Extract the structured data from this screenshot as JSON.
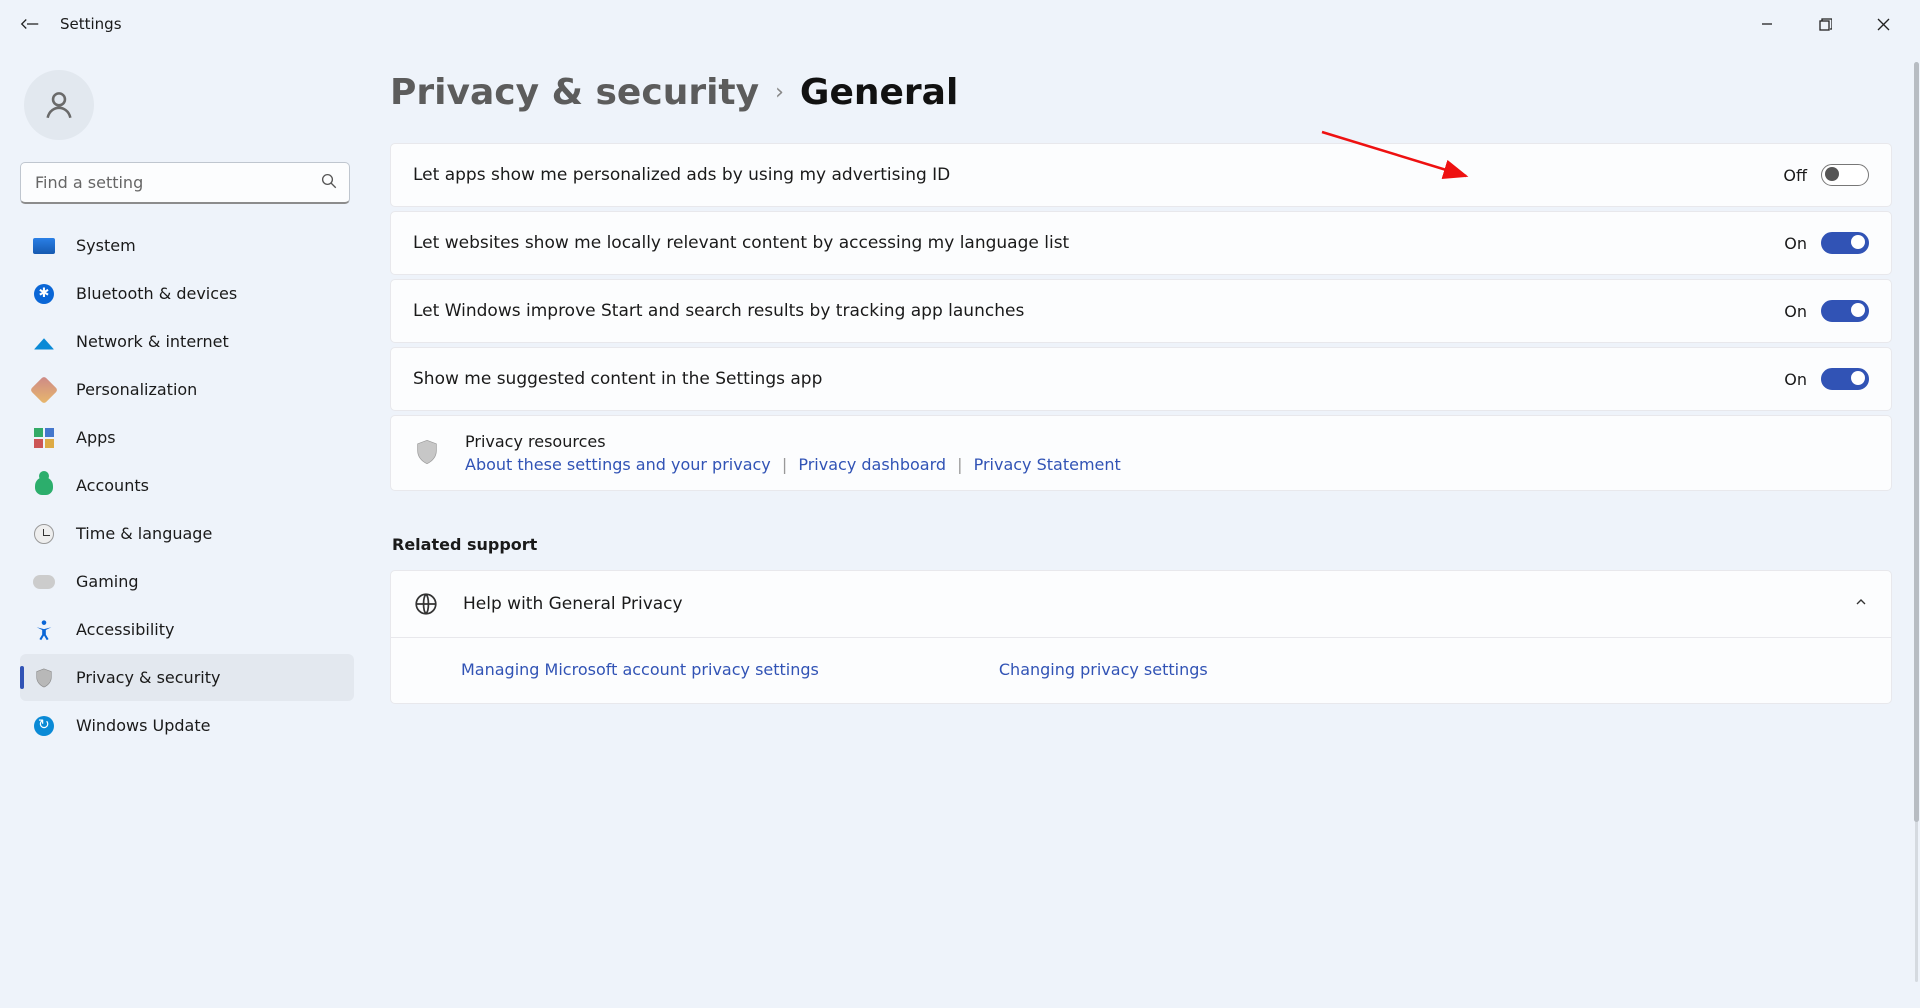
{
  "window": {
    "title": "Settings"
  },
  "search": {
    "placeholder": "Find a setting"
  },
  "sidebar": {
    "items": [
      {
        "label": "System"
      },
      {
        "label": "Bluetooth & devices"
      },
      {
        "label": "Network & internet"
      },
      {
        "label": "Personalization"
      },
      {
        "label": "Apps"
      },
      {
        "label": "Accounts"
      },
      {
        "label": "Time & language"
      },
      {
        "label": "Gaming"
      },
      {
        "label": "Accessibility"
      },
      {
        "label": "Privacy & security"
      },
      {
        "label": "Windows Update"
      }
    ]
  },
  "breadcrumb": {
    "parent": "Privacy & security",
    "current": "General"
  },
  "toggles": [
    {
      "label": "Let apps show me personalized ads by using my advertising ID",
      "state": "Off",
      "on": false
    },
    {
      "label": "Let websites show me locally relevant content by accessing my language list",
      "state": "On",
      "on": true
    },
    {
      "label": "Let Windows improve Start and search results by tracking app launches",
      "state": "On",
      "on": true
    },
    {
      "label": "Show me suggested content in the Settings app",
      "state": "On",
      "on": true
    }
  ],
  "resources": {
    "title": "Privacy resources",
    "links": [
      "About these settings and your privacy",
      "Privacy dashboard",
      "Privacy Statement"
    ]
  },
  "related": {
    "heading": "Related support",
    "help_title": "Help with General Privacy",
    "sublinks": [
      "Managing Microsoft account privacy settings",
      "Changing privacy settings"
    ]
  }
}
